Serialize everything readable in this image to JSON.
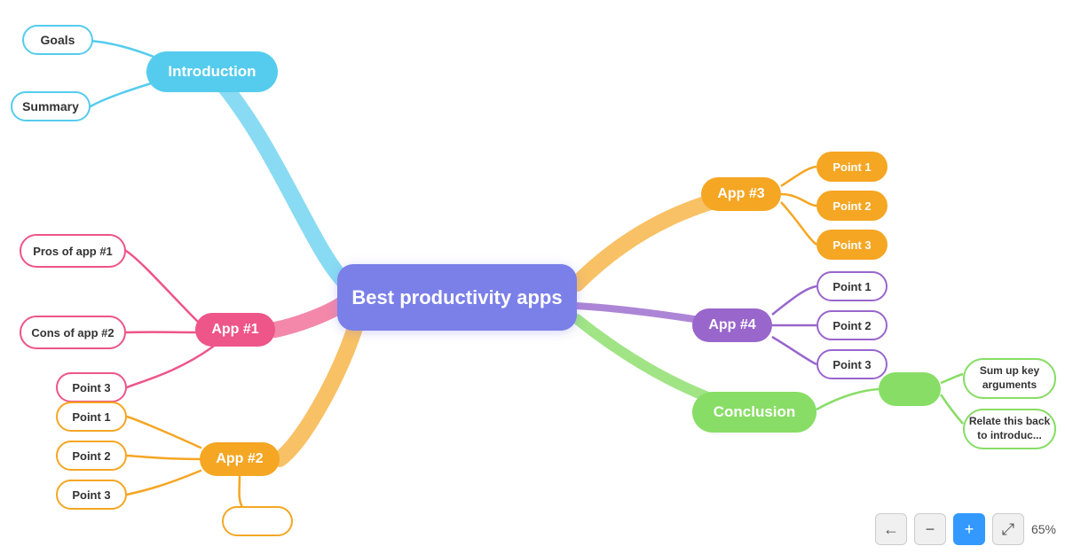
{
  "central": {
    "label": "Best productivity apps"
  },
  "introduction": {
    "label": "Introduction"
  },
  "goals": {
    "label": "Goals"
  },
  "summary": {
    "label": "Summary"
  },
  "app1": {
    "label": "App #1"
  },
  "pros": {
    "label": "Pros of app #1"
  },
  "cons": {
    "label": "Cons of app #2"
  },
  "app1_p3": {
    "label": "Point 3"
  },
  "app2": {
    "label": "App #2"
  },
  "app2_p1": {
    "label": "Point 1"
  },
  "app2_p2": {
    "label": "Point 2"
  },
  "app2_p3": {
    "label": "Point 3"
  },
  "app2_empty": {
    "label": ""
  },
  "app3": {
    "label": "App #3"
  },
  "app3_p1": {
    "label": "Point 1"
  },
  "app3_p2": {
    "label": "Point 2"
  },
  "app3_p3": {
    "label": "Point 3"
  },
  "app4": {
    "label": "App #4"
  },
  "app4_p1": {
    "label": "Point 1"
  },
  "app4_p2": {
    "label": "Point 2"
  },
  "app4_p3": {
    "label": "Point 3"
  },
  "conclusion": {
    "label": "Conclusion"
  },
  "conclusion_green": {
    "label": ""
  },
  "conclusion_sum": {
    "label": "Sum up key arguments"
  },
  "conclusion_relate": {
    "label": "Relate this back to introduc..."
  },
  "toolbar": {
    "zoom": "65%",
    "back_label": "←",
    "forward_label": "→",
    "add_label": "+",
    "fit_label": "⤢",
    "zoom_label": "65%"
  }
}
